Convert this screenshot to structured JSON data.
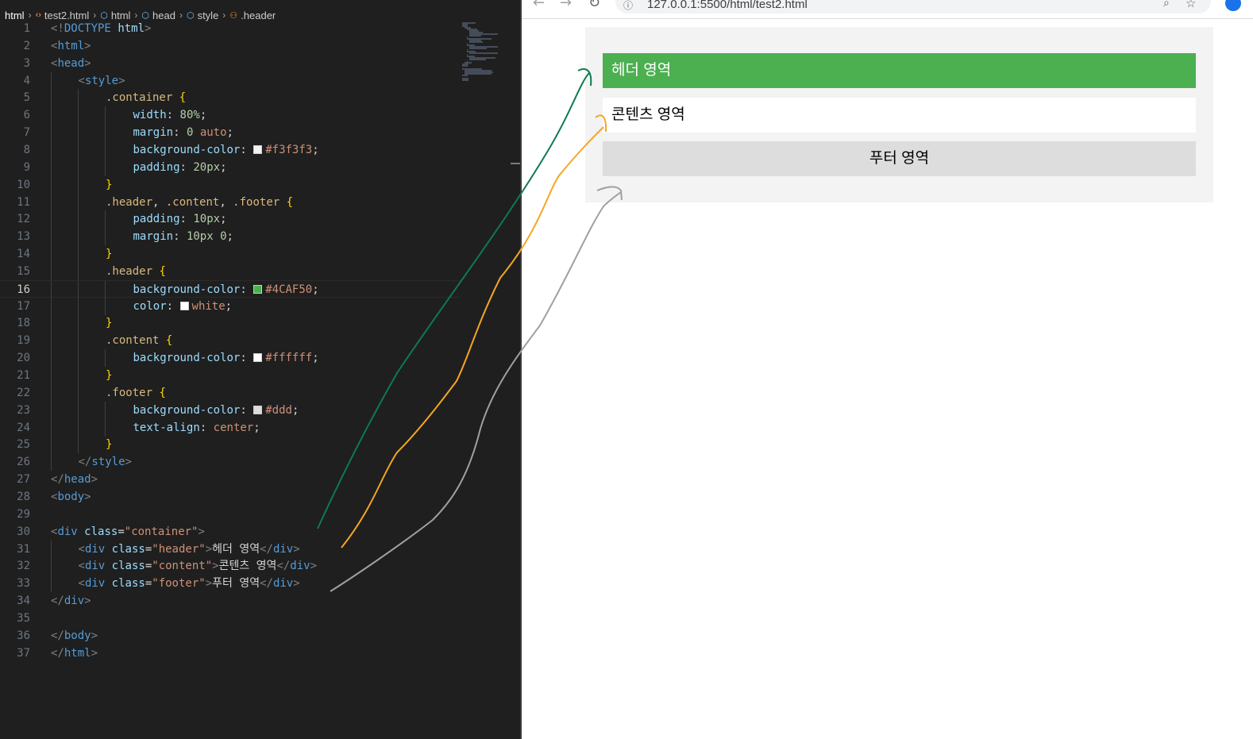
{
  "breadcrumb": {
    "items": [
      "html",
      "test2.html",
      "html",
      "head",
      "style",
      ".header"
    ]
  },
  "editor": {
    "active_line": 16,
    "lines": [
      {
        "n": "1",
        "indent": 0,
        "tokens": [
          [
            "pun",
            "<!"
          ],
          [
            "tag",
            "DOCTYPE"
          ],
          [
            "txt",
            " "
          ],
          [
            "attr",
            "html"
          ],
          [
            "pun",
            ">"
          ]
        ]
      },
      {
        "n": "2",
        "indent": 0,
        "tokens": [
          [
            "pun",
            "<"
          ],
          [
            "tag",
            "html"
          ],
          [
            "pun",
            ">"
          ]
        ]
      },
      {
        "n": "3",
        "indent": 0,
        "tokens": [
          [
            "pun",
            "<"
          ],
          [
            "tag",
            "head"
          ],
          [
            "pun",
            ">"
          ]
        ]
      },
      {
        "n": "4",
        "indent": 1,
        "tokens": [
          [
            "pun",
            "<"
          ],
          [
            "tag",
            "style"
          ],
          [
            "pun",
            ">"
          ]
        ]
      },
      {
        "n": "5",
        "indent": 2,
        "tokens": [
          [
            "sel",
            ".container"
          ],
          [
            "txt",
            " "
          ],
          [
            "brc",
            "{"
          ]
        ]
      },
      {
        "n": "6",
        "indent": 3,
        "tokens": [
          [
            "prop",
            "width"
          ],
          [
            "txt",
            ": "
          ],
          [
            "num",
            "80%"
          ],
          [
            "txt",
            ";"
          ]
        ]
      },
      {
        "n": "7",
        "indent": 3,
        "tokens": [
          [
            "prop",
            "margin"
          ],
          [
            "txt",
            ": "
          ],
          [
            "num",
            "0"
          ],
          [
            "txt",
            " "
          ],
          [
            "val",
            "auto"
          ],
          [
            "txt",
            ";"
          ]
        ]
      },
      {
        "n": "8",
        "indent": 3,
        "tokens": [
          [
            "prop",
            "background-color"
          ],
          [
            "txt",
            ": "
          ],
          [
            "sw",
            "#f3f3f3"
          ],
          [
            "val",
            "#f3f3f3"
          ],
          [
            "txt",
            ";"
          ]
        ]
      },
      {
        "n": "9",
        "indent": 3,
        "tokens": [
          [
            "prop",
            "padding"
          ],
          [
            "txt",
            ": "
          ],
          [
            "num",
            "20px"
          ],
          [
            "txt",
            ";"
          ]
        ]
      },
      {
        "n": "10",
        "indent": 2,
        "tokens": [
          [
            "brc",
            "}"
          ]
        ]
      },
      {
        "n": "11",
        "indent": 2,
        "tokens": [
          [
            "sel",
            ".header"
          ],
          [
            "txt",
            ", "
          ],
          [
            "sel",
            ".content"
          ],
          [
            "txt",
            ", "
          ],
          [
            "sel",
            ".footer"
          ],
          [
            "txt",
            " "
          ],
          [
            "brc",
            "{"
          ]
        ]
      },
      {
        "n": "12",
        "indent": 3,
        "tokens": [
          [
            "prop",
            "padding"
          ],
          [
            "txt",
            ": "
          ],
          [
            "num",
            "10px"
          ],
          [
            "txt",
            ";"
          ]
        ]
      },
      {
        "n": "13",
        "indent": 3,
        "tokens": [
          [
            "prop",
            "margin"
          ],
          [
            "txt",
            ": "
          ],
          [
            "num",
            "10px 0"
          ],
          [
            "txt",
            ";"
          ]
        ]
      },
      {
        "n": "14",
        "indent": 2,
        "tokens": [
          [
            "brc",
            "}"
          ]
        ]
      },
      {
        "n": "15",
        "indent": 2,
        "tokens": [
          [
            "sel",
            ".header"
          ],
          [
            "txt",
            " "
          ],
          [
            "brc",
            "{"
          ]
        ]
      },
      {
        "n": "16",
        "indent": 3,
        "tokens": [
          [
            "prop",
            "background-color"
          ],
          [
            "txt",
            ": "
          ],
          [
            "sw",
            "#4CAF50"
          ],
          [
            "val",
            "#4CAF50"
          ],
          [
            "txt",
            ";"
          ]
        ]
      },
      {
        "n": "17",
        "indent": 3,
        "tokens": [
          [
            "prop",
            "color"
          ],
          [
            "txt",
            ": "
          ],
          [
            "sw",
            "#ffffff"
          ],
          [
            "val",
            "white"
          ],
          [
            "txt",
            ";"
          ]
        ]
      },
      {
        "n": "18",
        "indent": 2,
        "tokens": [
          [
            "brc",
            "}"
          ]
        ]
      },
      {
        "n": "19",
        "indent": 2,
        "tokens": [
          [
            "sel",
            ".content"
          ],
          [
            "txt",
            " "
          ],
          [
            "brc",
            "{"
          ]
        ]
      },
      {
        "n": "20",
        "indent": 3,
        "tokens": [
          [
            "prop",
            "background-color"
          ],
          [
            "txt",
            ": "
          ],
          [
            "sw",
            "#ffffff"
          ],
          [
            "val",
            "#ffffff"
          ],
          [
            "txt",
            ";"
          ]
        ]
      },
      {
        "n": "21",
        "indent": 2,
        "tokens": [
          [
            "brc",
            "}"
          ]
        ]
      },
      {
        "n": "22",
        "indent": 2,
        "tokens": [
          [
            "sel",
            ".footer"
          ],
          [
            "txt",
            " "
          ],
          [
            "brc",
            "{"
          ]
        ]
      },
      {
        "n": "23",
        "indent": 3,
        "tokens": [
          [
            "prop",
            "background-color"
          ],
          [
            "txt",
            ": "
          ],
          [
            "sw",
            "#dddddd"
          ],
          [
            "val",
            "#ddd"
          ],
          [
            "txt",
            ";"
          ]
        ]
      },
      {
        "n": "24",
        "indent": 3,
        "tokens": [
          [
            "prop",
            "text-align"
          ],
          [
            "txt",
            ": "
          ],
          [
            "val",
            "center"
          ],
          [
            "txt",
            ";"
          ]
        ]
      },
      {
        "n": "25",
        "indent": 2,
        "tokens": [
          [
            "brc",
            "}"
          ]
        ]
      },
      {
        "n": "26",
        "indent": 1,
        "tokens": [
          [
            "pun",
            "</"
          ],
          [
            "tag",
            "style"
          ],
          [
            "pun",
            ">"
          ]
        ]
      },
      {
        "n": "27",
        "indent": 0,
        "tokens": [
          [
            "pun",
            "</"
          ],
          [
            "tag",
            "head"
          ],
          [
            "pun",
            ">"
          ]
        ]
      },
      {
        "n": "28",
        "indent": 0,
        "tokens": [
          [
            "pun",
            "<"
          ],
          [
            "tag",
            "body"
          ],
          [
            "pun",
            ">"
          ]
        ]
      },
      {
        "n": "29",
        "indent": 0,
        "tokens": []
      },
      {
        "n": "30",
        "indent": 0,
        "tokens": [
          [
            "pun",
            "<"
          ],
          [
            "tag",
            "div"
          ],
          [
            "txt",
            " "
          ],
          [
            "attr",
            "class"
          ],
          [
            "txt",
            "="
          ],
          [
            "str",
            "\"container\""
          ],
          [
            "pun",
            ">"
          ]
        ]
      },
      {
        "n": "31",
        "indent": 1,
        "tokens": [
          [
            "pun",
            "<"
          ],
          [
            "tag",
            "div"
          ],
          [
            "txt",
            " "
          ],
          [
            "attr",
            "class"
          ],
          [
            "txt",
            "="
          ],
          [
            "str",
            "\"header\""
          ],
          [
            "pun",
            ">"
          ],
          [
            "txt",
            "헤더 영역"
          ],
          [
            "pun",
            "</"
          ],
          [
            "tag",
            "div"
          ],
          [
            "pun",
            ">"
          ]
        ]
      },
      {
        "n": "32",
        "indent": 1,
        "tokens": [
          [
            "pun",
            "<"
          ],
          [
            "tag",
            "div"
          ],
          [
            "txt",
            " "
          ],
          [
            "attr",
            "class"
          ],
          [
            "txt",
            "="
          ],
          [
            "str",
            "\"content\""
          ],
          [
            "pun",
            ">"
          ],
          [
            "txt",
            "콘텐츠 영역"
          ],
          [
            "pun",
            "</"
          ],
          [
            "tag",
            "div"
          ],
          [
            "pun",
            ">"
          ]
        ]
      },
      {
        "n": "33",
        "indent": 1,
        "tokens": [
          [
            "pun",
            "<"
          ],
          [
            "tag",
            "div"
          ],
          [
            "txt",
            " "
          ],
          [
            "attr",
            "class"
          ],
          [
            "txt",
            "="
          ],
          [
            "str",
            "\"footer\""
          ],
          [
            "pun",
            ">"
          ],
          [
            "txt",
            "푸터 영역"
          ],
          [
            "pun",
            "</"
          ],
          [
            "tag",
            "div"
          ],
          [
            "pun",
            ">"
          ]
        ]
      },
      {
        "n": "34",
        "indent": 0,
        "tokens": [
          [
            "pun",
            "</"
          ],
          [
            "tag",
            "div"
          ],
          [
            "pun",
            ">"
          ]
        ]
      },
      {
        "n": "35",
        "indent": 0,
        "tokens": []
      },
      {
        "n": "36",
        "indent": 0,
        "tokens": [
          [
            "pun",
            "</"
          ],
          [
            "tag",
            "body"
          ],
          [
            "pun",
            ">"
          ]
        ]
      },
      {
        "n": "37",
        "indent": 0,
        "tokens": [
          [
            "pun",
            "</"
          ],
          [
            "tag",
            "html"
          ],
          [
            "pun",
            ">"
          ]
        ]
      }
    ]
  },
  "browser": {
    "back_icon": "arrow-left-icon",
    "forward_icon": "arrow-right-icon",
    "reload_icon": "reload-icon",
    "url": "127.0.0.1:5500/html/test2.html",
    "icons": [
      "info-icon",
      "zoom-icon",
      "star-icon",
      "profile-icon"
    ]
  },
  "preview": {
    "header_text": "헤더 영역",
    "content_text": "콘텐츠 영역",
    "footer_text": "푸터 영역",
    "colors": {
      "container": "#f3f3f3",
      "header": "#4caf50",
      "content": "#ffffff",
      "footer": "#dddddd"
    }
  },
  "annotations": {
    "colors": [
      "#0e7a4e",
      "#f5a623",
      "#a0a0a0"
    ]
  }
}
